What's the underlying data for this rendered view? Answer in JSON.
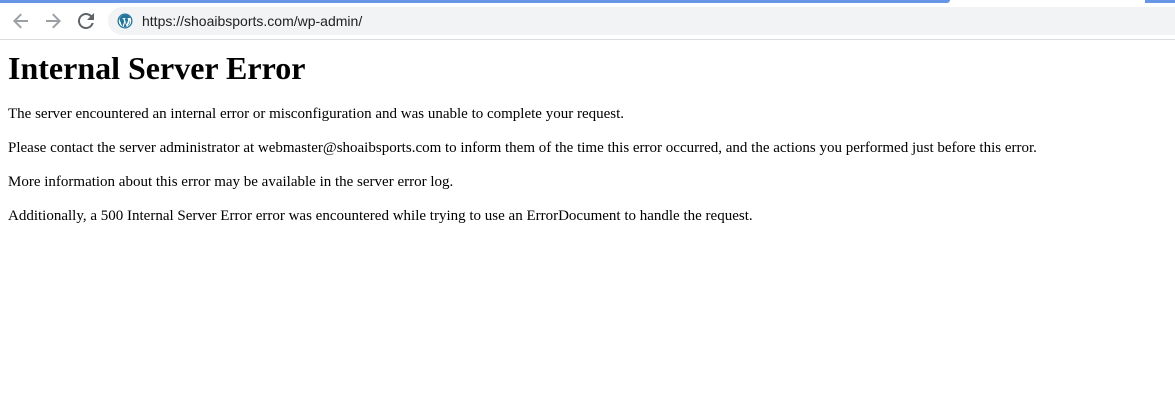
{
  "browser": {
    "url": "https://shoaibsports.com/wp-admin/",
    "site_icon": "wordpress-icon",
    "nav_icons": [
      "back-arrow-icon",
      "forward-arrow-icon",
      "reload-icon"
    ]
  },
  "page": {
    "title": "Internal Server Error",
    "paragraphs": [
      "The server encountered an internal error or misconfiguration and was unable to complete your request.",
      "Please contact the server administrator at webmaster@shoaibsports.com to inform them of the time this error occurred, and the actions you performed just before this error.",
      "More information about this error may be available in the server error log.",
      "Additionally, a 500 Internal Server Error error was encountered while trying to use an ErrorDocument to handle the request."
    ]
  },
  "colors": {
    "tab_accent": "#6796e6",
    "omnibox_bg": "#f1f3f4",
    "icon_gray": "#5f6368"
  }
}
